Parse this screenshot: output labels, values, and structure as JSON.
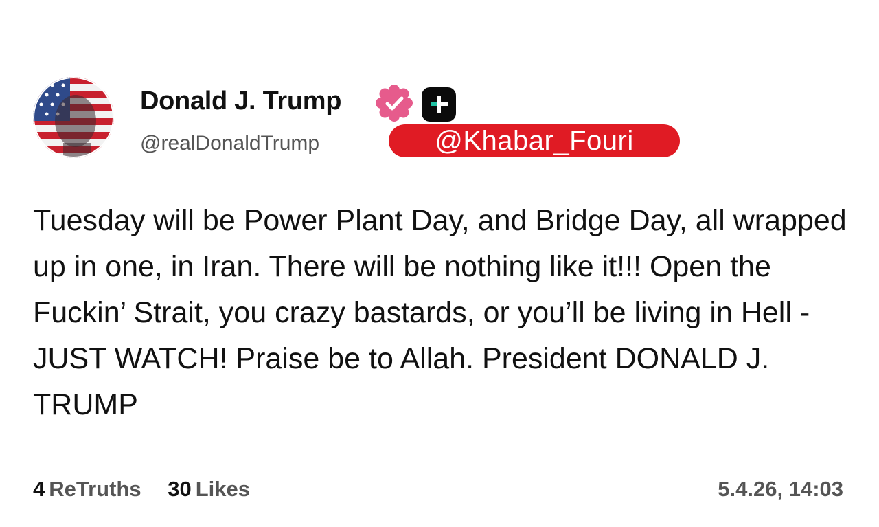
{
  "author": {
    "display_name": "Donald J. Trump",
    "username": "@realDonaldTrump",
    "verified": true,
    "avatar_icon": "flag-portrait-avatar",
    "badge_icons": [
      "verified-badge-icon",
      "plus-badge-icon"
    ]
  },
  "watermark": {
    "text": "@Khabar_Fouri",
    "color": "#e01b24"
  },
  "post": {
    "text": "Tuesday will be Power Plant Day, and Bridge Day, all wrapped up in one, in Iran. There will be nothing like it!!! Open the Fuckin’ Strait, you crazy bastards, or you’ll be living in Hell - JUST WATCH! Praise be to Allah. President DONALD J. TRUMP"
  },
  "stats": {
    "retruths_count": "4",
    "retruths_label": "ReTruths",
    "likes_count": "30",
    "likes_label": "Likes"
  },
  "timestamp": "5.4.26, 14:03",
  "colors": {
    "badge_pink": "#e65b8c",
    "accent_teal": "#21c4a6",
    "text_primary": "#111111",
    "text_secondary": "#555555"
  }
}
